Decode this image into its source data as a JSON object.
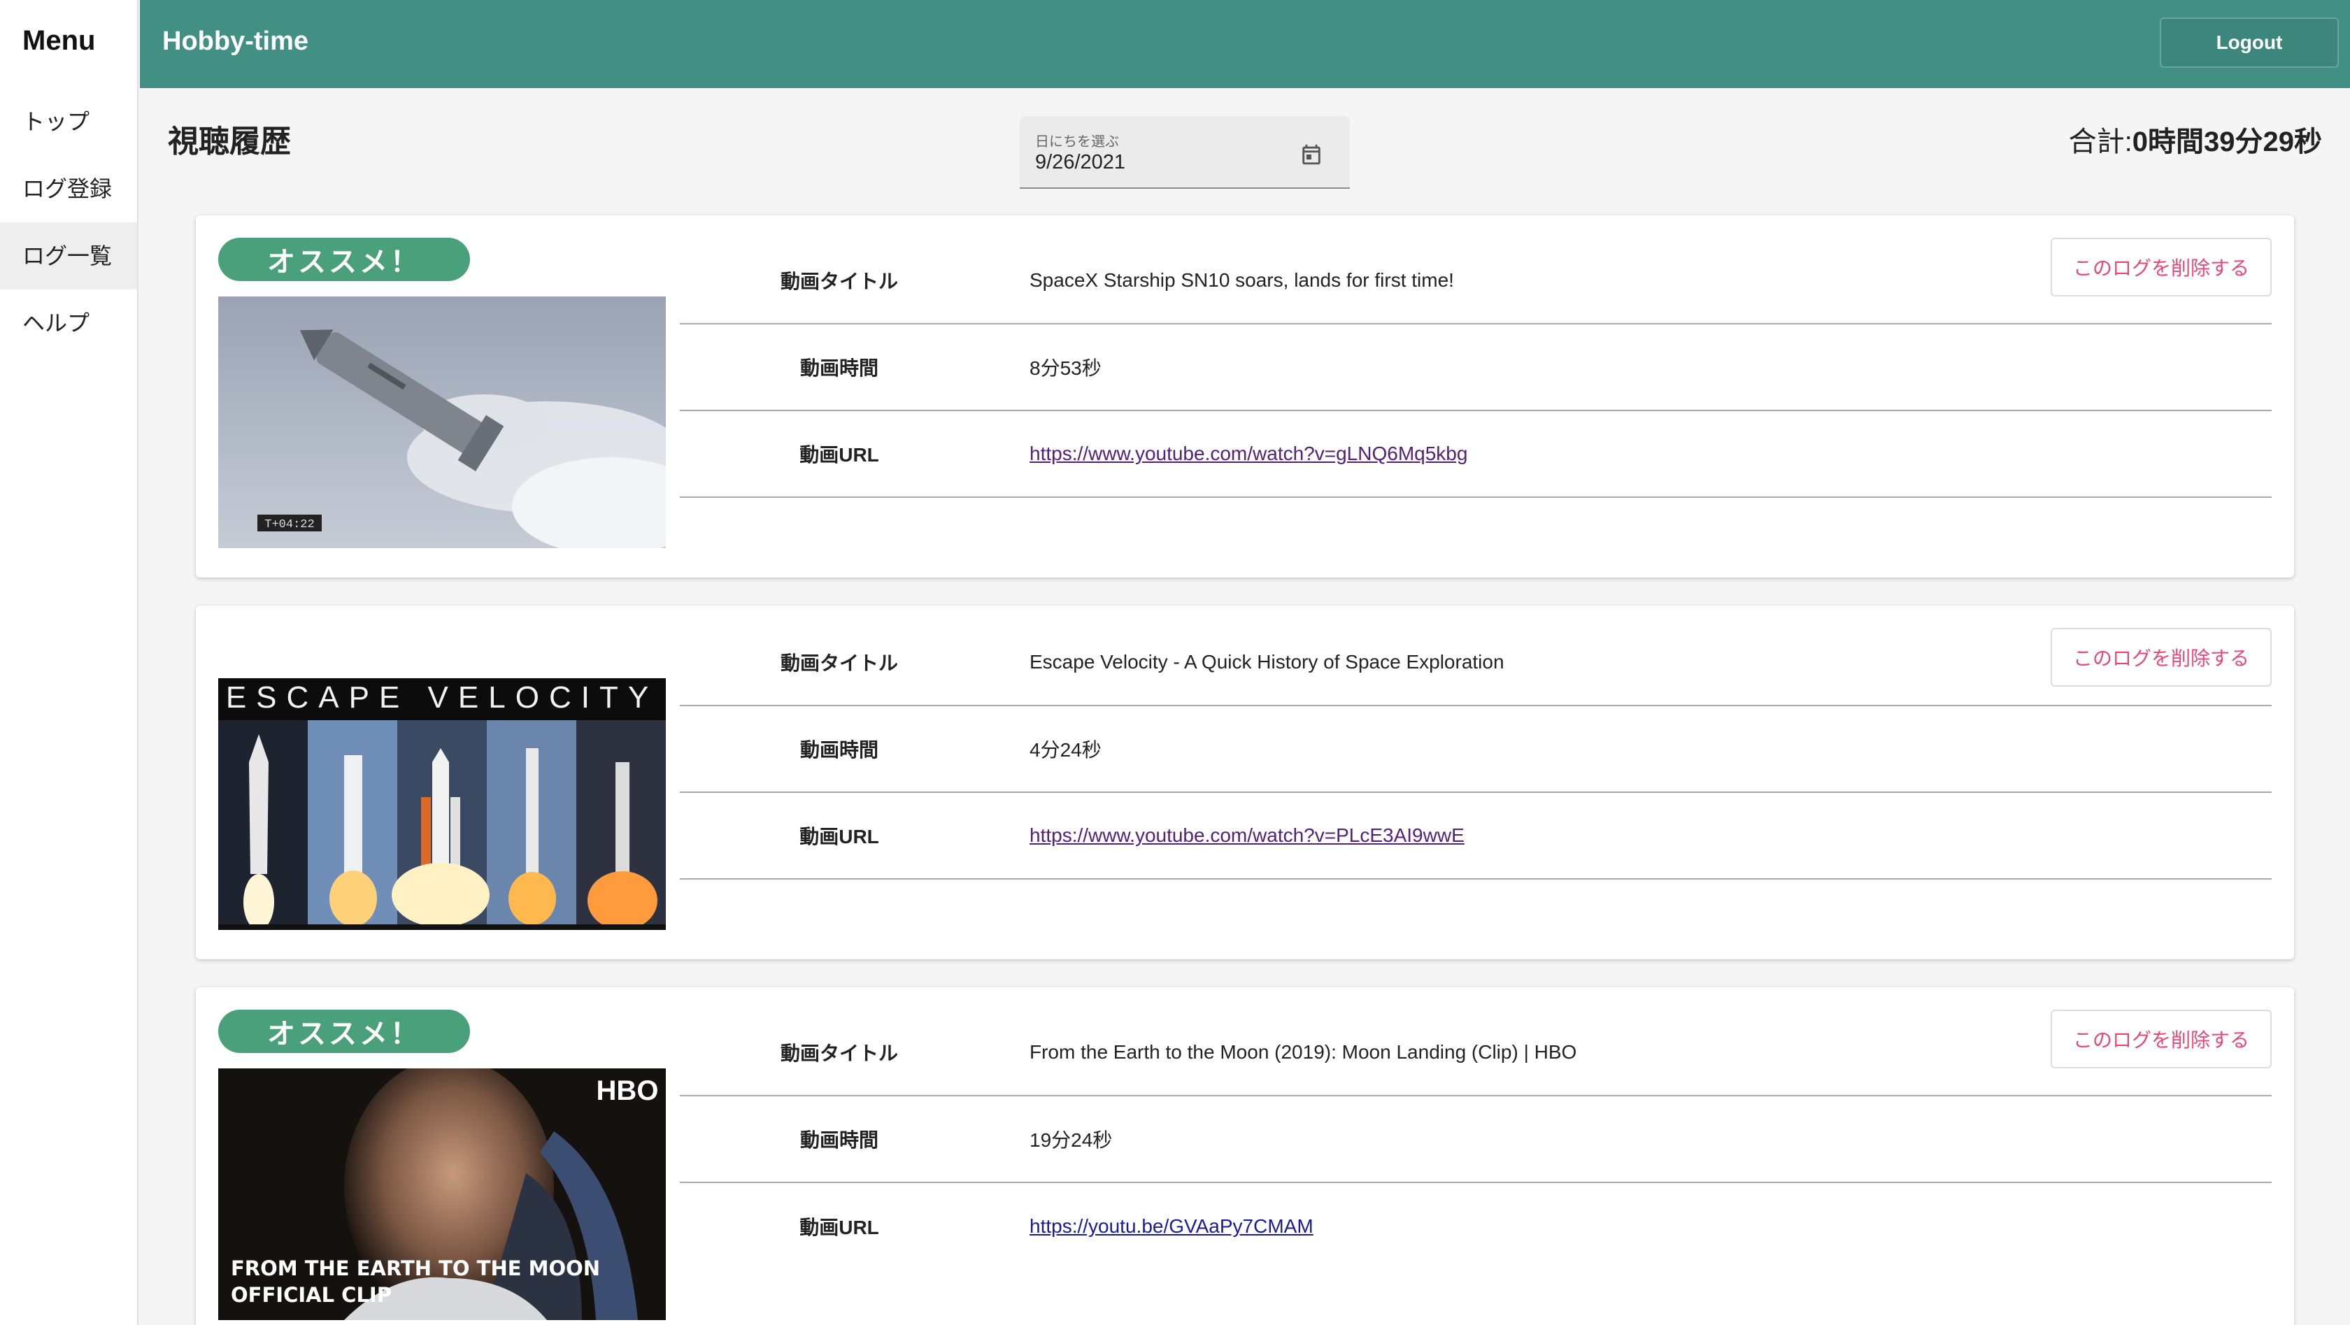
{
  "sidebar": {
    "title": "Menu",
    "items": [
      {
        "label": "トップ"
      },
      {
        "label": "ログ登録"
      },
      {
        "label": "ログ一覧"
      },
      {
        "label": "ヘルプ"
      }
    ]
  },
  "header": {
    "title": "Hobby-time",
    "logout_label": "Logout",
    "color": "#428f84"
  },
  "page": {
    "title": "視聴履歴",
    "date_picker": {
      "label": "日にちを選ぶ",
      "value": "9/26/2021",
      "icon": "calendar-icon"
    },
    "total": {
      "prefix": "合計:",
      "value": "0時間39分29秒"
    }
  },
  "labels": {
    "recommend": "オススメ！",
    "delete": "このログを削除する",
    "title_key": "動画タイトル",
    "duration_key": "動画時間",
    "url_key": "動画URL"
  },
  "logs": [
    {
      "recommended": true,
      "title": "SpaceX Starship SN10 soars, lands for first time!",
      "duration": "8分53秒",
      "url": "https://www.youtube.com/watch?v=gLNQ6Mq5kbg",
      "thumb_timecode": "T+04:22"
    },
    {
      "recommended": false,
      "title": "Escape Velocity - A Quick History of Space Exploration",
      "duration": "4分24秒",
      "url": "https://www.youtube.com/watch?v=PLcE3AI9wwE",
      "thumb_caption": "ESCAPE VELOCITY"
    },
    {
      "recommended": true,
      "title": "From the Earth to the Moon (2019): Moon Landing (Clip) | HBO",
      "duration": "19分24秒",
      "url": "https://youtu.be/GVAaPy7CMAM",
      "thumb_brand": "HBO",
      "thumb_caption_line1": "FROM THE EARTH TO THE MOON",
      "thumb_caption_line2": "OFFICIAL CLIP"
    }
  ]
}
